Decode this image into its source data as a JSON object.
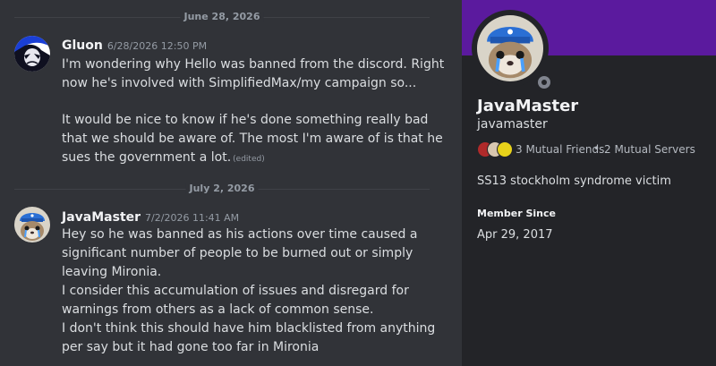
{
  "chat": {
    "divider_1": "June 28, 2026",
    "divider_2": "July 2, 2026",
    "messages": [
      {
        "author": "Gluon",
        "timestamp": "6/28/2026 12:50 PM",
        "lines": [
          "I'm wondering why Hello was banned from the discord. Right",
          "now he's involved with SimplifiedMax/my campaign so...",
          "",
          "It would be nice to know if he's done something really bad",
          "that we should be aware of. The most I'm aware of is that he",
          "sues the government a lot."
        ],
        "edited": "(edited)"
      },
      {
        "author": "JavaMaster",
        "timestamp": "7/2/2026 11:41 AM",
        "lines": [
          "Hey so he was banned as his actions over time caused a",
          "significant number of people to be burned out or simply",
          "leaving Mironia.",
          "I consider this accumulation of issues and disregard for",
          "warnings from others as a lack of common sense.",
          "I don't think this should have him blacklisted from anything",
          "per say but it had gone too far in Mironia"
        ]
      }
    ]
  },
  "profile": {
    "display_name": "JavaMaster",
    "username": "javamaster",
    "mutual_friends": "3 Mutual Friends",
    "separator": "•",
    "mutual_servers": "2 Mutual Servers",
    "bio": "SS13 stockholm syndrome victim",
    "member_since_label": "Member Since",
    "member_since": "Apr 29, 2017",
    "banner_color": "#5b1a9e",
    "status": "offline"
  }
}
